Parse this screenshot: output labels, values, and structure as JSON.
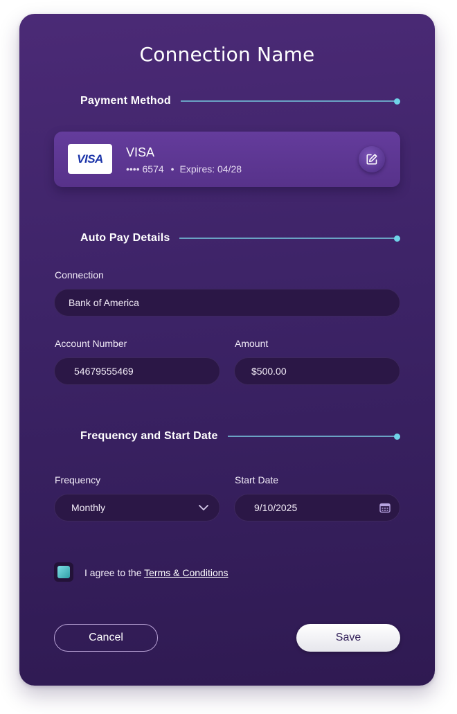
{
  "dialog": {
    "title": "Connection Name"
  },
  "sections": {
    "payment": "Payment Method",
    "autopay": "Auto Pay Details",
    "frequency": "Frequency and Start Date"
  },
  "card": {
    "logo_text": "VISA",
    "brand": "VISA",
    "masked_number": "•••• 6574",
    "separator": "•",
    "expires": "Expires: 04/28"
  },
  "fields": {
    "connection": {
      "label": "Connection",
      "value": "Bank of America"
    },
    "account_number": {
      "label": "Account Number",
      "value": "54679555469"
    },
    "amount": {
      "label": "Amount",
      "value": "$500.00"
    },
    "frequency": {
      "label": "Frequency",
      "value": "Monthly"
    },
    "start_date": {
      "label": "Start Date",
      "value": "9/10/2025"
    }
  },
  "agreement": {
    "prefix": "I agree to the ",
    "link": "Terms & Conditions",
    "checked": true
  },
  "buttons": {
    "cancel": "Cancel",
    "save": "Save"
  },
  "colors": {
    "accent_line": "#6aa2c4",
    "accent_dot": "#6fd3e8",
    "checkbox": "#3fb3b9"
  }
}
